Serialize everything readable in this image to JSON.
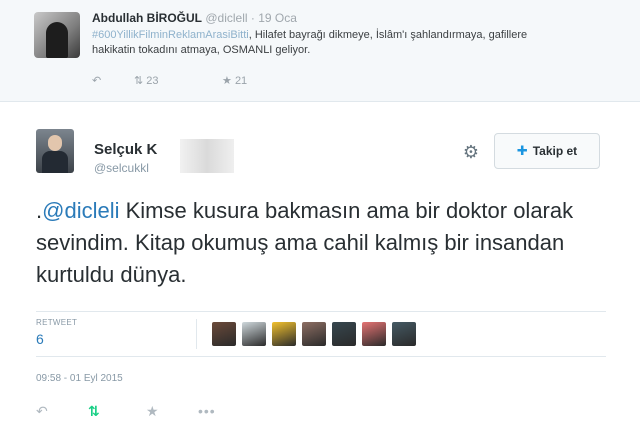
{
  "quoted_tweet": {
    "name": "Abdullah BİROĞUL",
    "handle": "@diclell",
    "separator": "·",
    "date": "19 Oca",
    "hashtag": "#600YillikFilminReklamArasiBitti",
    "text": ", Hilafet bayrağı dikmeye, İslâm'ı şahlandırmaya, gafillere hakikatin tokadını atmaya, OSMANLI geliyor.",
    "retweets": "23",
    "favorites": "21",
    "icons": {
      "reply": "reply-icon",
      "retweet": "retweet-icon",
      "favorite": "star-icon"
    }
  },
  "main_tweet": {
    "name": "Selçuk K",
    "handle": "@selcukkl",
    "follow_label": "Takip et",
    "mention": "@dicleli",
    "text_prefix": ".",
    "text": " Kimse kusura bakmasın ama bir doktor olarak sevindim. Kitap okumuş ama cahil kalmış bir insandan kurtuldu dünya.",
    "retweet_label": "RETWEET",
    "retweet_count": "6",
    "timestamp": "09:58 - 01 Eyl 2015",
    "retweeter_avatar_colors": [
      "#6b4a3a",
      "#cfd8dc",
      "#f2c12e",
      "#8d6e63",
      "#37474f",
      "#e57373",
      "#455a64"
    ],
    "icons": {
      "settings": "gear-icon",
      "follow": "add-user-icon",
      "reply": "reply-icon",
      "retweet": "retweet-icon",
      "favorite": "star-icon",
      "more": "more-icon"
    },
    "accent_color": "#2b7bb9",
    "retweet_color": "#19cf86"
  }
}
